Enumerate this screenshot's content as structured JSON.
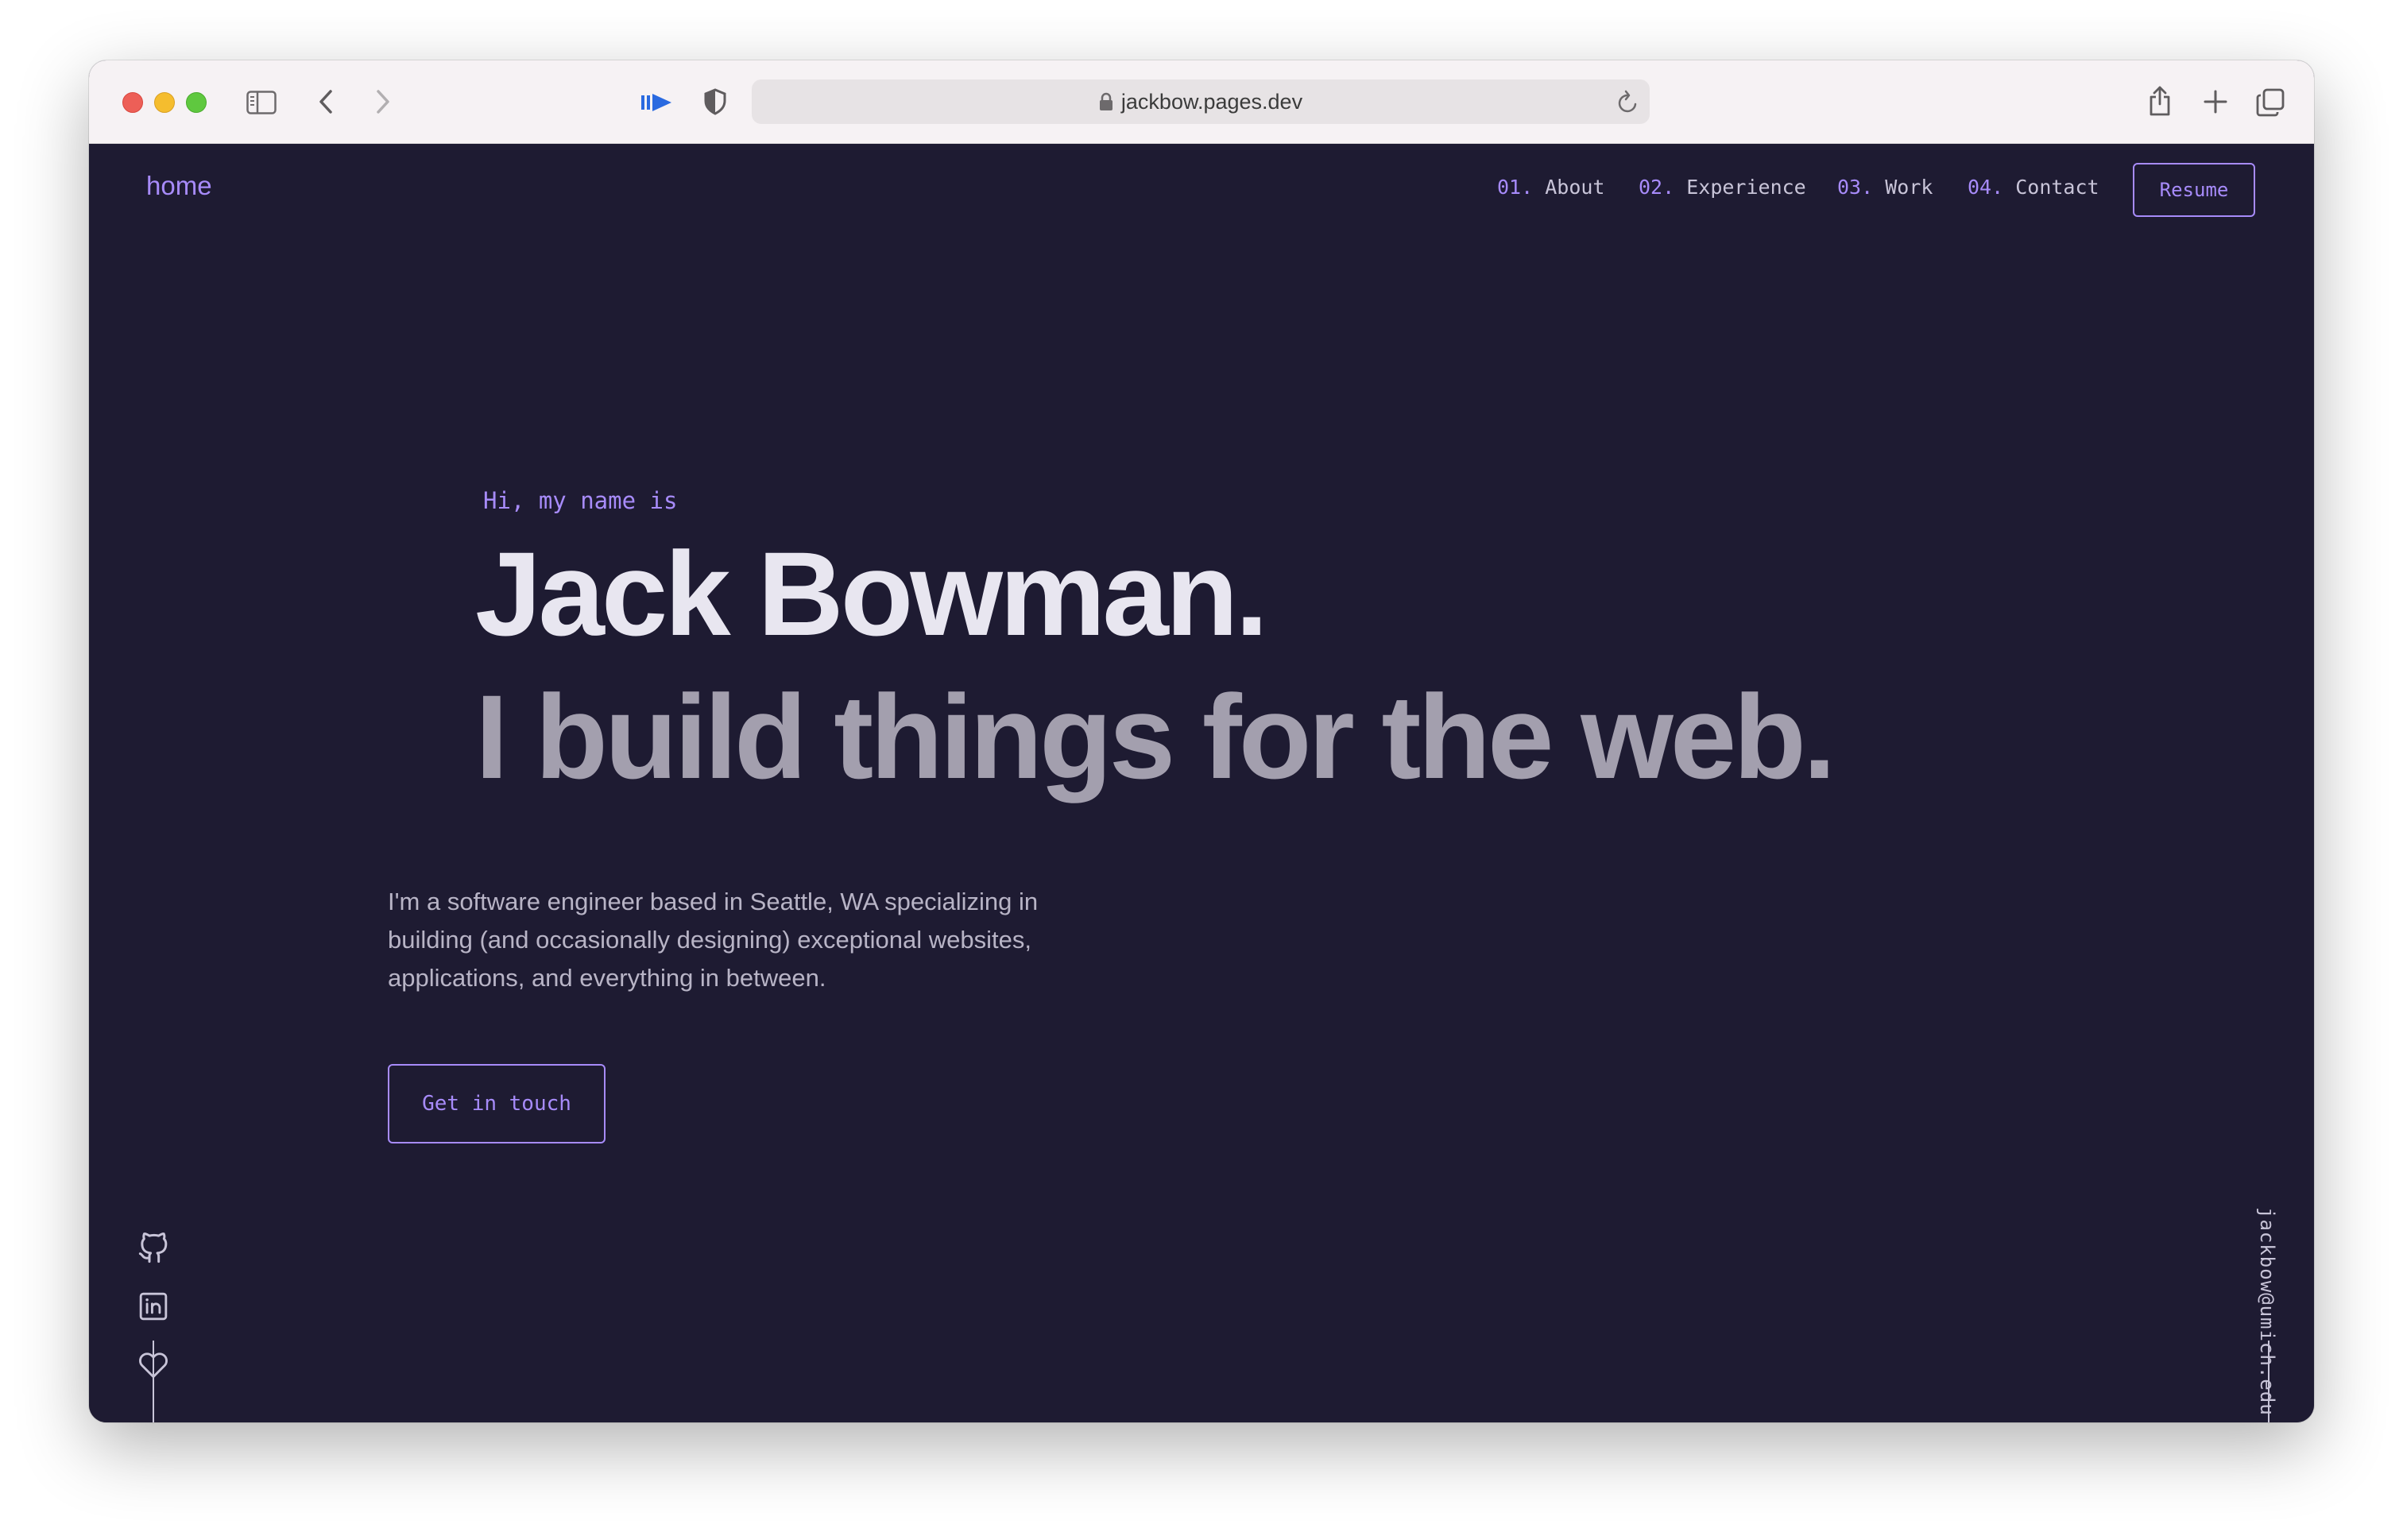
{
  "browser": {
    "url": "jackbow.pages.dev"
  },
  "header": {
    "logo": "home",
    "nav": [
      {
        "num": "01.",
        "label": "About"
      },
      {
        "num": "02.",
        "label": "Experience"
      },
      {
        "num": "03.",
        "label": "Work"
      },
      {
        "num": "04.",
        "label": "Contact"
      }
    ],
    "resume_label": "Resume"
  },
  "hero": {
    "greeting": "Hi, my name is",
    "name": "Jack Bowman.",
    "tagline": "I build things for the web.",
    "bio": "I'm a software engineer based in Seattle, WA specializing in building (and occasionally designing) exceptional websites, applications, and everything in between.",
    "cta_label": "Get in touch"
  },
  "sidebar": {
    "email": "jackbow@umich.edu",
    "social_icons": [
      "github-icon",
      "linkedin-icon",
      "heart-icon"
    ]
  },
  "colors": {
    "background": "#1e1b32",
    "accent": "#a78bfa",
    "heading": "#e8e6f0",
    "subheading": "#a39fae",
    "body_text": "#b8b4c6"
  }
}
